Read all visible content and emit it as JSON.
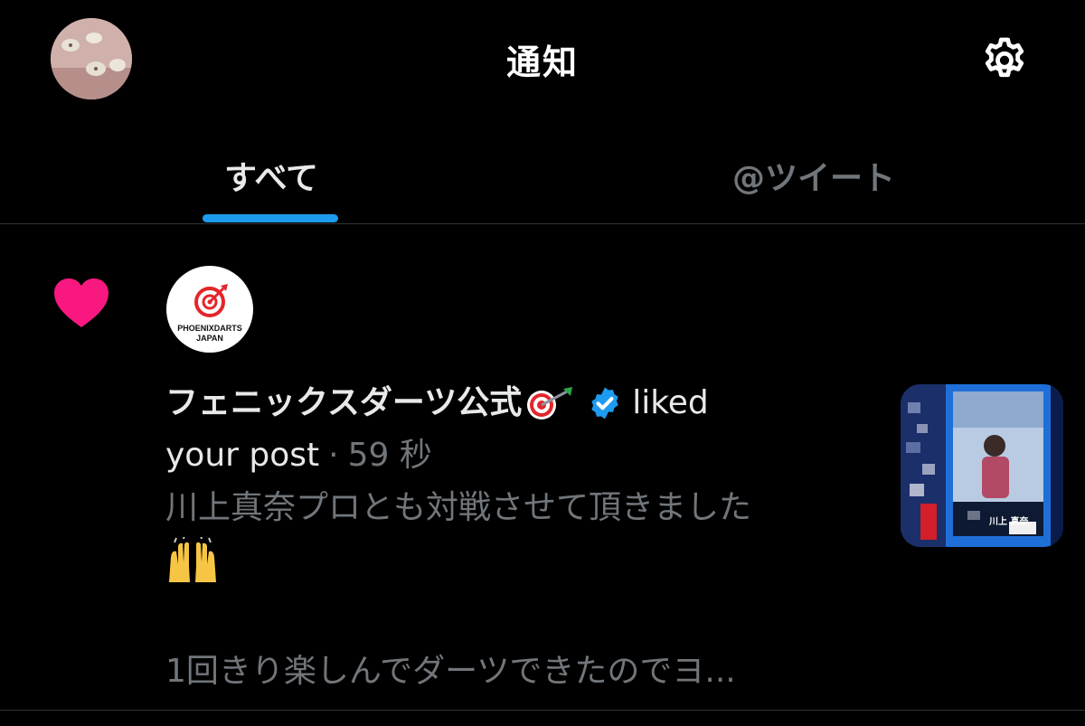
{
  "header": {
    "title": "通知",
    "profile_avatar": "profile-photo",
    "settings_icon": "gear-icon"
  },
  "tabs": [
    {
      "label": "すべて",
      "active": true
    },
    {
      "label": "@ツイート",
      "active": false
    }
  ],
  "notification": {
    "type_icon": "heart-icon",
    "account_logo": {
      "line1": "PHOENIXDARTS",
      "line2": "JAPAN"
    },
    "account_name": "フェニックスダーツ公式",
    "name_emoji": "dart-bullseye-icon",
    "verified": true,
    "action_part1": "liked",
    "action_part2": "your post",
    "separator": "·",
    "timestamp": "59 秒",
    "tweet_line1": "川上真奈プロとも対戦させて頂きました",
    "tweet_emoji": "raised-hands-icon",
    "tweet_line2": "1回きり楽しんでダーツできたのでヨ...",
    "thumbnail": {
      "caption": "川上 真奈"
    }
  },
  "colors": {
    "background": "#000000",
    "accent": "#1d9bf0",
    "heart": "#f91880",
    "muted": "#71767b",
    "text": "#e7e9ea"
  }
}
